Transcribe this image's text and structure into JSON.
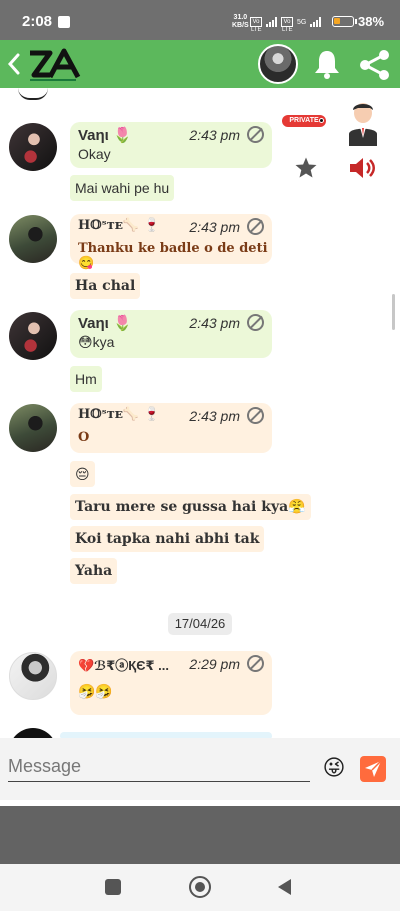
{
  "status_bar": {
    "time": "2:08",
    "speed_value": "31.0",
    "speed_unit": "KB/S",
    "network_1": "Vo LTE",
    "network_2": "Vo LTE",
    "network_3": "5G",
    "battery_percent": "38%",
    "battery_level": 0.38
  },
  "header": {
    "logo_text": "ZA"
  },
  "private_badge": "PRIVATE",
  "messages": [
    {
      "sender": "Vaηι 🌷",
      "time": "2:43 pm",
      "text": "Okay",
      "followups": [
        "Mai wahi pe hu"
      ]
    },
    {
      "sender": "H𝕆ˢᴛᴇ🦴 🍷",
      "time": "2:43 pm",
      "text": "Thanku ke badle o de deti😋",
      "followups": [
        "Ha chal"
      ]
    },
    {
      "sender": "Vaηι 🌷",
      "time": "2:43 pm",
      "text": "😳kya",
      "followups": [
        "Hm"
      ]
    },
    {
      "sender": "H𝕆ˢᴛᴇ🦴 🍷",
      "time": "2:43 pm",
      "text": "O",
      "followups": [
        "😔",
        "Taru mere se gussa hai kya😤",
        "Koi tapka nahi abhi tak",
        "Yaha"
      ]
    },
    {
      "sender": "💔ℬ₹ⓐҚЄ₹ ...",
      "time": "2:29 pm",
      "text": "🤧🤧",
      "followups": []
    }
  ],
  "date_divider": "17/04/26",
  "composer": {
    "placeholder": "Message",
    "emoji": "😜"
  },
  "colors": {
    "app_bar": "#5cb85c",
    "green_bubble": "#ecf8d8",
    "orange_bubble": "#fff1e0",
    "send_button": "#ff6b3d",
    "private_badge": "#e53935"
  }
}
